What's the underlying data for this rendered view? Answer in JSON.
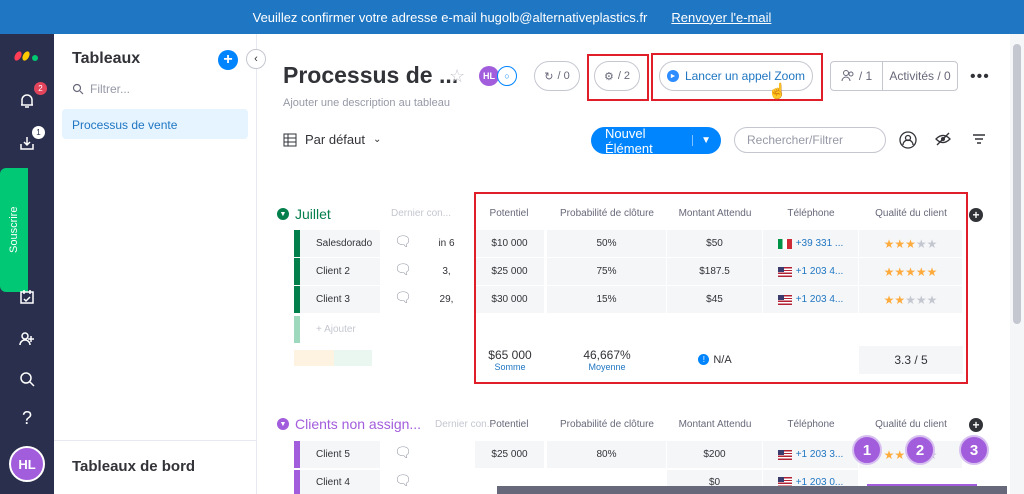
{
  "banner": {
    "text": "Veuillez confirmer votre adresse e-mail hugolb@alternativeplastics.fr",
    "link": "Renvoyer l'e-mail"
  },
  "rail": {
    "notif_badge": "2",
    "inbox_badge": "1",
    "subscribe": "Souscrire",
    "avatar": "HL"
  },
  "sidebar": {
    "title": "Tableaux",
    "filter_placeholder": "Filtrer...",
    "items": [
      {
        "label": "Processus de vente"
      }
    ],
    "bottom_title": "Tableaux de bord"
  },
  "board": {
    "title": "Processus de ...",
    "subtitle": "Ajouter une description au tableau",
    "avatar_initials": "HL",
    "integrations_count": "/ 0",
    "automations_count": "/ 2",
    "zoom_label": "Lancer un appel Zoom",
    "members_count": "/ 1",
    "activities_label": "Activités / 0",
    "view_label": "Par défaut",
    "new_item_label": "Nouvel Élément",
    "search_placeholder": "Rechercher/Filtrer"
  },
  "columns": [
    "Potentiel",
    "Probabilité de clôture",
    "Montant Attendu",
    "Téléphone",
    "Qualité du client"
  ],
  "groups": [
    {
      "name": "Juillet",
      "color": "#037f4c",
      "hidden_col": "Dernier con...",
      "add_label": "+ Ajouter",
      "rows": [
        {
          "name": "Salesdorado",
          "partial": "in 6",
          "potentiel": "$10 000",
          "proba": "50%",
          "montant": "$50",
          "flag": "it",
          "phone": "+39 331 ...",
          "stars": 3
        },
        {
          "name": "Client 2",
          "partial": "3,",
          "potentiel": "$25 000",
          "proba": "75%",
          "montant": "$187.5",
          "flag": "us",
          "phone": "+1 203 4...",
          "stars": 5
        },
        {
          "name": "Client 3",
          "partial": "29,",
          "potentiel": "$30 000",
          "proba": "15%",
          "montant": "$45",
          "flag": "us",
          "phone": "+1 203 4...",
          "stars": 2
        }
      ],
      "summary": {
        "potentiel": "$65 000",
        "potentiel_lbl": "Somme",
        "proba": "46,667%",
        "proba_lbl": "Moyenne",
        "montant": "N/A",
        "quality": "3.3 / 5"
      }
    },
    {
      "name": "Clients non assign...",
      "color": "#a25ddc",
      "hidden_col": "Dernier con...",
      "rows": [
        {
          "name": "Client 5",
          "potentiel": "$25 000",
          "proba": "80%",
          "montant": "$200",
          "flag": "us",
          "phone": "+1 203 3...",
          "stars": 4
        },
        {
          "name": "Client 4",
          "potentiel": "",
          "proba": "",
          "montant": "$0",
          "flag": "us",
          "phone": "+1 203 0...",
          "stars": 3
        }
      ]
    }
  ],
  "steps": [
    "1",
    "2",
    "3"
  ],
  "colors": {
    "accent": "#0085ff",
    "highlight": "#e01e2a",
    "banner": "#1f76c2",
    "rail": "#292f4c",
    "step": "#a25ddc"
  }
}
